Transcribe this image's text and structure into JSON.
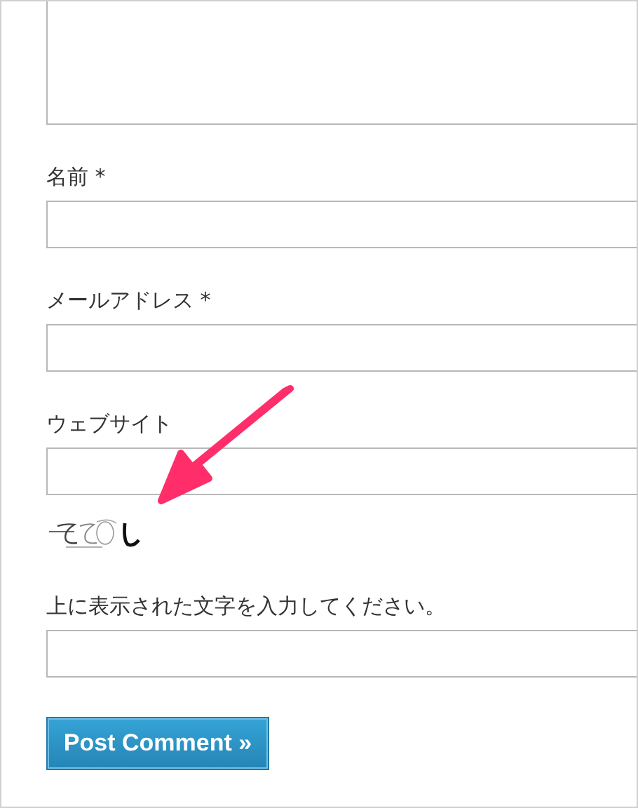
{
  "form": {
    "items": [
      {
        "kind": "textarea"
      },
      {
        "kind": "input",
        "label": "名前 *"
      },
      {
        "kind": "input",
        "label": "メールアドレス *"
      },
      {
        "kind": "input",
        "label": "ウェブサイト"
      },
      {
        "kind": "captcha"
      },
      {
        "kind": "input",
        "label": "上に表示された文字を入力してください。"
      }
    ],
    "submit": "Post Comment »"
  }
}
